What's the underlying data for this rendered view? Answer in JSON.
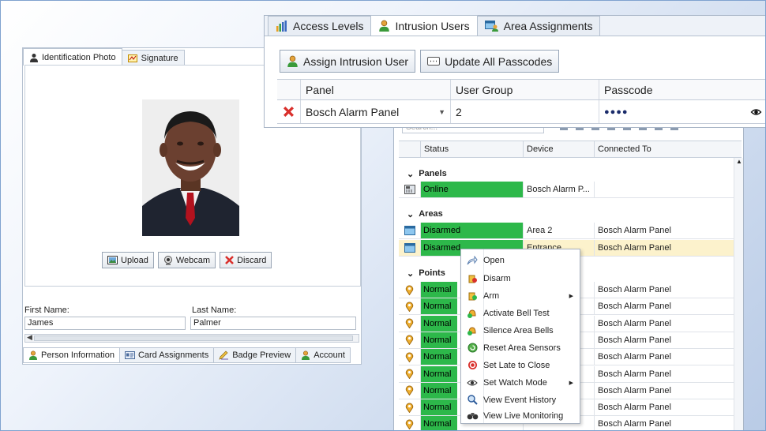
{
  "person_panel": {
    "photo_tabs": [
      {
        "label": "Identification Photo",
        "icon": "person-silhouette-icon"
      },
      {
        "label": "Signature",
        "icon": "signature-icon"
      }
    ],
    "photo_buttons": [
      {
        "label": "Upload",
        "icon": "upload-icon"
      },
      {
        "label": "Webcam",
        "icon": "webcam-icon"
      },
      {
        "label": "Discard",
        "icon": "red-x-icon"
      }
    ],
    "first_name_label": "First Name:",
    "first_name_value": "James",
    "last_name_label": "Last Name:",
    "last_name_value": "Palmer",
    "bottom_tabs": [
      {
        "label": "Person Information",
        "icon": "person-icon"
      },
      {
        "label": "Card Assignments",
        "icon": "card-icon"
      },
      {
        "label": "Badge Preview",
        "icon": "badge-icon"
      },
      {
        "label": "Account",
        "icon": "account-icon"
      }
    ]
  },
  "intrusion_panel": {
    "tabs": [
      {
        "label": "Access Levels",
        "icon": "bar-chart-icon"
      },
      {
        "label": "Intrusion Users",
        "icon": "person-icon"
      },
      {
        "label": "Area Assignments",
        "icon": "area-assignments-icon"
      }
    ],
    "buttons": [
      {
        "label": "Assign Intrusion User",
        "icon": "person-icon"
      },
      {
        "label": "Update All Passcodes",
        "icon": "keypad-icon"
      }
    ],
    "columns": [
      "Panel",
      "User Group",
      "Passcode"
    ],
    "row": {
      "panel": "Bosch Alarm Panel",
      "user_group": "2",
      "passcode": "●●●●"
    }
  },
  "status_panel": {
    "search_placeholder": "Search...",
    "columns": [
      "Status",
      "Device",
      "Connected To"
    ],
    "groups": {
      "panels": "Panels",
      "areas": "Areas",
      "points": "Points"
    },
    "panel_rows": [
      {
        "status": "Online",
        "device": "Bosch Alarm P...",
        "connected": ""
      }
    ],
    "area_rows": [
      {
        "status": "Disarmed",
        "device": "Area 2",
        "connected": "Bosch Alarm Panel"
      },
      {
        "status": "Disarmed",
        "device": "Entrance",
        "connected": "Bosch Alarm Panel"
      }
    ],
    "point_rows": [
      {
        "status": "Normal",
        "connected": "Bosch Alarm Panel"
      },
      {
        "status": "Normal",
        "connected": "Bosch Alarm Panel"
      },
      {
        "status": "Normal",
        "connected": "Bosch Alarm Panel"
      },
      {
        "status": "Normal",
        "connected": "Bosch Alarm Panel"
      },
      {
        "status": "Normal",
        "connected": "Bosch Alarm Panel"
      },
      {
        "status": "Normal",
        "connected": "Bosch Alarm Panel"
      },
      {
        "status": "Normal",
        "connected": "Bosch Alarm Panel"
      },
      {
        "status": "Normal",
        "connected": "Bosch Alarm Panel"
      },
      {
        "status": "Normal",
        "connected": "Bosch Alarm Panel"
      }
    ]
  },
  "context_menu": [
    {
      "label": "Open",
      "icon": "open-arrow-icon"
    },
    {
      "label": "Disarm",
      "icon": "disarm-icon"
    },
    {
      "label": "Arm",
      "icon": "arm-icon",
      "submenu": true
    },
    {
      "label": "Activate Bell Test",
      "icon": "bell-test-icon"
    },
    {
      "label": "Silence Area Bells",
      "icon": "silence-bell-icon"
    },
    {
      "label": "Reset Area Sensors",
      "icon": "reset-icon"
    },
    {
      "label": "Set Late to Close",
      "icon": "late-close-icon"
    },
    {
      "label": "Set Watch Mode",
      "icon": "eye-icon",
      "submenu": true
    },
    {
      "label": "View Event History",
      "icon": "magnifier-icon"
    },
    {
      "label": "View Live Monitoring",
      "icon": "binoculars-icon"
    }
  ],
  "colors": {
    "status_green": "#2db84a",
    "selected_row": "#fcf2cc",
    "delete_red": "#d9302c"
  }
}
